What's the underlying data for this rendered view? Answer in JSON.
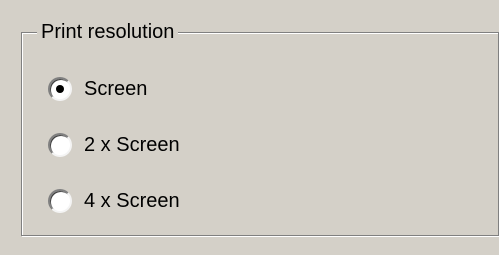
{
  "group": {
    "title": "Print resolution",
    "options": [
      {
        "label": "Screen",
        "selected": true
      },
      {
        "label": "2 x Screen",
        "selected": false
      },
      {
        "label": "4 x Screen",
        "selected": false
      }
    ]
  }
}
